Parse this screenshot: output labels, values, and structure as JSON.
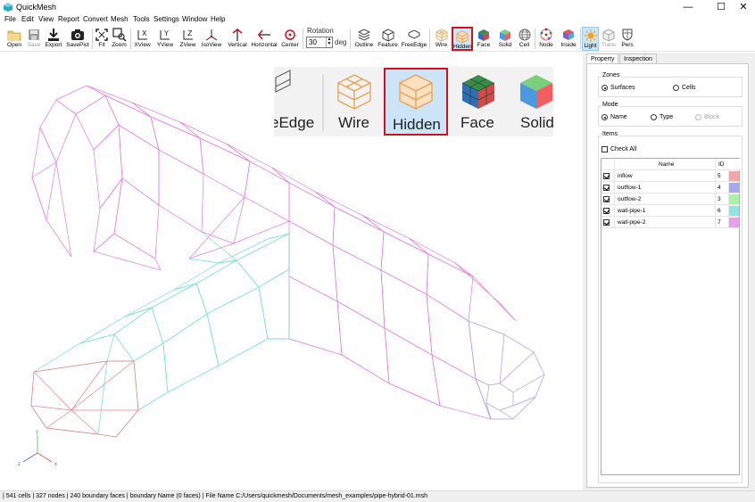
{
  "window": {
    "title": "QuickMesh",
    "minimize": "—",
    "maximize": "☐",
    "close": "✕"
  },
  "menu": [
    "File",
    "Edit",
    "View",
    "Report",
    "Convert",
    "Mesh",
    "Tools",
    "Settings",
    "Window",
    "Help"
  ],
  "toolbar": {
    "buttons": [
      {
        "label": "Open",
        "icon": "folder-open-icon"
      },
      {
        "label": "Save",
        "icon": "save-disk-icon",
        "disabled": true
      },
      {
        "label": "Export",
        "icon": "export-download-icon"
      },
      {
        "label": "SavePict",
        "icon": "camera-icon"
      },
      {
        "label": "Fit",
        "icon": "fit-view-icon"
      },
      {
        "label": "Zoom",
        "icon": "zoom-icon"
      },
      {
        "label": "XView",
        "icon": "x-view-axes-icon"
      },
      {
        "label": "YView",
        "icon": "y-view-axes-icon"
      },
      {
        "label": "ZView",
        "icon": "z-view-axes-icon"
      },
      {
        "label": "IsoView",
        "icon": "iso-view-axes-icon"
      },
      {
        "label": "Vertical",
        "icon": "vertical-flip-icon"
      },
      {
        "label": "Horizontal",
        "icon": "horizontal-flip-icon"
      },
      {
        "label": "Center",
        "icon": "center-target-icon"
      },
      {
        "label": "Outline",
        "icon": "outline-layers-icon"
      },
      {
        "label": "Feature",
        "icon": "feature-cube-icon"
      },
      {
        "label": "FreeEdge",
        "icon": "free-edge-icon"
      },
      {
        "label": "Wire",
        "icon": "wire-cube-icon"
      },
      {
        "label": "Hidden",
        "icon": "hidden-cube-icon",
        "active": true
      },
      {
        "label": "Face",
        "icon": "face-cube-icon"
      },
      {
        "label": "Solid",
        "icon": "solid-cube-icon"
      },
      {
        "label": "Cell",
        "icon": "cell-sphere-icon"
      },
      {
        "label": "Node",
        "icon": "node-dots-icon"
      },
      {
        "label": "Inside",
        "icon": "inside-sphere-icon"
      },
      {
        "label": "Light",
        "icon": "light-sun-icon",
        "active": true
      },
      {
        "label": "Trans",
        "icon": "transparent-cube-icon",
        "disabled": true
      },
      {
        "label": "Pers",
        "icon": "perspective-shield-icon"
      }
    ],
    "rotation": {
      "label": "Rotation",
      "value": "30",
      "unit": "deg"
    }
  },
  "zoom_inset": {
    "labels": [
      "eEdge",
      "Wire",
      "Hidden",
      "Face",
      "Solid"
    ]
  },
  "panel": {
    "tabs": [
      {
        "label": "Property",
        "selected": true
      },
      {
        "label": "Inspection",
        "selected": false
      }
    ],
    "zones": {
      "title": "Zones",
      "options": [
        {
          "label": "Surfaces",
          "checked": true
        },
        {
          "label": "Cells",
          "checked": false
        }
      ]
    },
    "mode": {
      "title": "Mode",
      "options": [
        {
          "label": "Name",
          "checked": true
        },
        {
          "label": "Type",
          "checked": false
        },
        {
          "label": "Block",
          "checked": false,
          "disabled": true
        }
      ]
    },
    "items": {
      "title": "Items",
      "check_all": "Check All",
      "columns": [
        "Name",
        "ID"
      ],
      "rows": [
        {
          "name": "inflow",
          "id": "5",
          "color": "#f4a6a6",
          "checked": true
        },
        {
          "name": "outflow-1",
          "id": "4",
          "color": "#a6a6f4",
          "checked": true
        },
        {
          "name": "outflow-2",
          "id": "3",
          "color": "#a6f4a6",
          "checked": true
        },
        {
          "name": "wall-pipe-1",
          "id": "6",
          "color": "#8ce6e2",
          "checked": true
        },
        {
          "name": "wall-pipe-2",
          "id": "7",
          "color": "#e8a0ea",
          "checked": true
        }
      ]
    }
  },
  "axes": {
    "x": "x",
    "y": "y",
    "z": "z"
  },
  "colors": {
    "pipe2": "#e079e6",
    "pipe1": "#6fdcd4",
    "inflow": "#f08080",
    "outflow1": "#a79aef",
    "highlight": "#d0121b",
    "active_bg": "#cce4f7"
  },
  "status": " | 541 cells | 327 nodes | 240 boundary faces |  boundary Name  (0 faces) | File Name C:/Users/quickmesh/Documents/mesh_examples/pipe-hybrid-01.msh"
}
